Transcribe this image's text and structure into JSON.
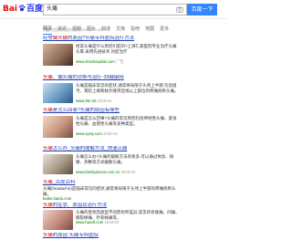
{
  "header": {
    "logo_text_1": "Bai",
    "logo_text_2": "百度",
    "search_value": "头痛",
    "search_button": "百度一下"
  },
  "tabs": [
    {
      "label": "网页",
      "active": true
    },
    {
      "label": "资讯"
    },
    {
      "label": "视频"
    },
    {
      "label": "图片"
    },
    {
      "label": "知道"
    },
    {
      "label": "文库"
    },
    {
      "label": "贴吧"
    },
    {
      "label": "地图"
    },
    {
      "label": "更多"
    }
  ],
  "stats": "百度为您找到相关结果约100,000,000个",
  "results": {
    "r1": {
      "title_pre": "经常",
      "title_hl": "偏头痛",
      "title_post": "的原因?头痛专科医院治疗方法",
      "snippet": "经常头痛是什么原因引起的?上海仁爱医院专业治疗头痛头晕,采用先进技术,对症治疗",
      "url": "www.shrahospital.com",
      "meta": "广告"
    },
    "r2": {
      "title_pre": "",
      "title_hl": "头痛",
      "title_post": "、偏头痛的诊断与治疗-39健康网",
      "snippet": "头痛是临床常见的症状,通常将局限于头颅上半部,包括眉弓、耳轮上缘和枕外隆突连线以上部位的疼痛统称头痛。",
      "url": "www.39.net",
      "meta": "2018-04"
    },
    "r3": {
      "title_pre": "",
      "title_hl": "头痛",
      "title_post": "是怎么回事?头痛的原因有哪些",
      "snippet": "头痛是怎么回事?头痛的常见原因包括神经性头痛、紧张性头痛、血管性头痛等多种类型。",
      "url": "www.xywy.com",
      "meta": "2018-04"
    },
    "r4": {
      "title_pre": "",
      "title_hl": "头痛",
      "title_post": "怎么办_头痛的缓解方法_快速止痛",
      "snippet": "头痛怎么办?头痛的缓解方法有很多,可以通过休息、按摩、热敷等方式缓解头痛。",
      "url": "www.familydoctor.com.cn",
      "meta": "2018-03"
    },
    "r5": {
      "title_pre": "",
      "title_hl": "头痛",
      "title_post": "_百度百科",
      "snippet": "头痛(headache)是临床常见的症状,通常将局限于头颅上半部的疼痛统称头痛。",
      "url": "baike.baidu.com",
      "meta": ""
    },
    "r6": {
      "title_pre": "",
      "title_hl": "头痛",
      "title_post": "的症状、原因及治疗方法",
      "snippet": "头痛的症状因类型不同而有所差异,常见的有胀痛、闷痛、撕裂样痛、针刺样痛等。",
      "url": "www.haodf.com",
      "meta": "2018-04"
    },
    "r7": {
      "title_pre": "",
      "title_hl": "头痛",
      "title_post": "的原因 头痛专科医院",
      "snippet": "",
      "url": "",
      "meta": ""
    }
  }
}
